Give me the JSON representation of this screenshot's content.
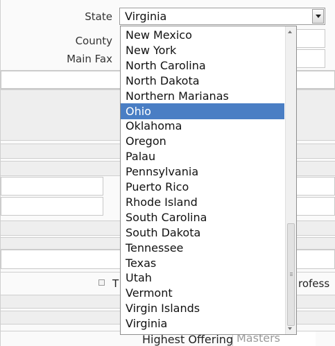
{
  "form": {
    "state_label": "State",
    "county_label": "County",
    "main_fax_label": "Main Fax",
    "state_value": "Virginia",
    "checkbox_partial_label": "T",
    "right_partial_label": "rofess",
    "highest_offering_label": "Highest Offering",
    "highest_offering_value": "Masters"
  },
  "dropdown": {
    "options": [
      "New Mexico",
      "New York",
      "North Carolina",
      "North Dakota",
      "Northern Marianas",
      "Ohio",
      "Oklahoma",
      "Oregon",
      "Palau",
      "Pennsylvania",
      "Puerto Rico",
      "Rhode Island",
      "South Carolina",
      "South Dakota",
      "Tennessee",
      "Texas",
      "Utah",
      "Vermont",
      "Virgin Islands",
      "Virginia"
    ],
    "highlighted_option": "Ohio"
  },
  "colors": {
    "highlight": "#4a7ec4",
    "band": "#eeeeee",
    "border": "#cfcfcf"
  }
}
